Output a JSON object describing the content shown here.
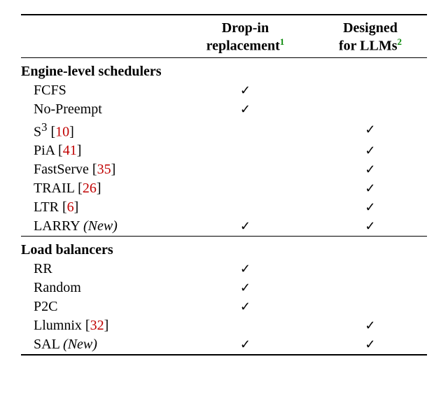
{
  "headers": {
    "blank": "",
    "col1_line1": "Drop-in",
    "col1_line2": "replacement",
    "col1_sup": "1",
    "col2_line1": "Designed",
    "col2_line2": "for LLMs",
    "col2_sup": "2"
  },
  "sections": [
    {
      "title": "Engine-level schedulers",
      "rows": [
        {
          "name": "FCFS",
          "cite": null,
          "new": false,
          "dropin": true,
          "llm": false
        },
        {
          "name": "No-Preempt",
          "cite": null,
          "new": false,
          "dropin": true,
          "llm": false
        },
        {
          "name": "S",
          "sup": "3",
          "cite": "10",
          "new": false,
          "dropin": false,
          "llm": true
        },
        {
          "name": "PiA",
          "cite": "41",
          "new": false,
          "dropin": false,
          "llm": true
        },
        {
          "name": "FastServe",
          "cite": "35",
          "new": false,
          "dropin": false,
          "llm": true
        },
        {
          "name": "TRAIL",
          "cite": "26",
          "new": false,
          "dropin": false,
          "llm": true
        },
        {
          "name": "LTR",
          "cite": "6",
          "new": false,
          "dropin": false,
          "llm": true
        },
        {
          "name": "LARRY",
          "cite": null,
          "new": true,
          "dropin": true,
          "llm": true
        }
      ]
    },
    {
      "title": "Load balancers",
      "rows": [
        {
          "name": "RR",
          "cite": null,
          "new": false,
          "dropin": true,
          "llm": false
        },
        {
          "name": "Random",
          "cite": null,
          "new": false,
          "dropin": true,
          "llm": false
        },
        {
          "name": "P2C",
          "cite": null,
          "new": false,
          "dropin": true,
          "llm": false
        },
        {
          "name": "Llumnix",
          "cite": "32",
          "new": false,
          "dropin": false,
          "llm": true
        },
        {
          "name": "SAL",
          "cite": null,
          "new": true,
          "dropin": true,
          "llm": true
        }
      ]
    }
  ],
  "glyphs": {
    "check": "✓",
    "new_label": "(New)"
  }
}
